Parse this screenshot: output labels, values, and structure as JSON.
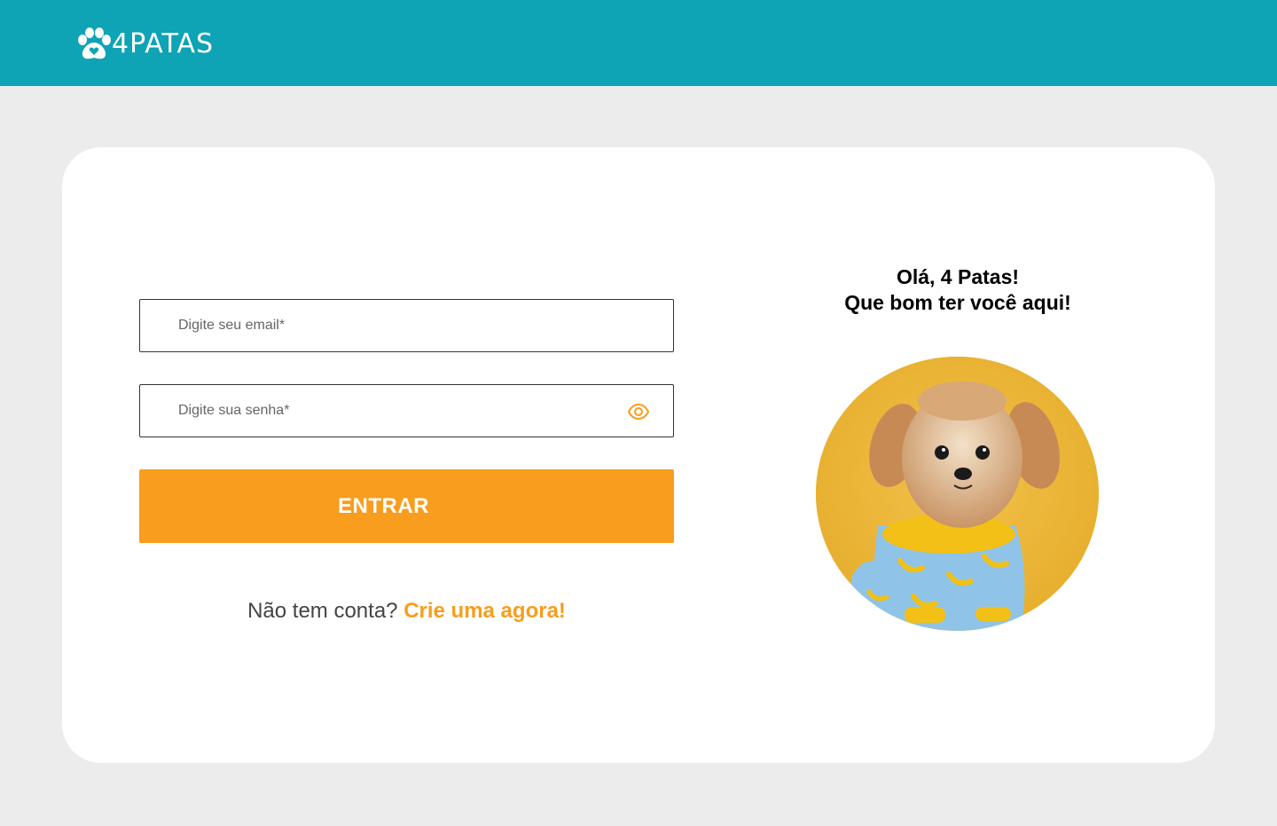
{
  "header": {
    "brand": "4PATAS",
    "logo_icon": "paw-heart-icon",
    "background_color": "#0ea3b5"
  },
  "login_form": {
    "email_placeholder": "Digite seu email*",
    "password_placeholder": "Digite sua senha*",
    "show_password_icon": "eye-icon",
    "submit_label": "ENTRAR",
    "signup_prompt": "Não tem conta?",
    "signup_link": "Crie uma agora!"
  },
  "welcome": {
    "line1": "Olá, 4 Patas!",
    "line2": "Que bom ter você aqui!",
    "image": "dog-in-banana-pajamas-photo"
  },
  "colors": {
    "accent": "#f89d1e",
    "header": "#0ea3b5",
    "page_background": "#ececec",
    "card_background": "#ffffff"
  }
}
